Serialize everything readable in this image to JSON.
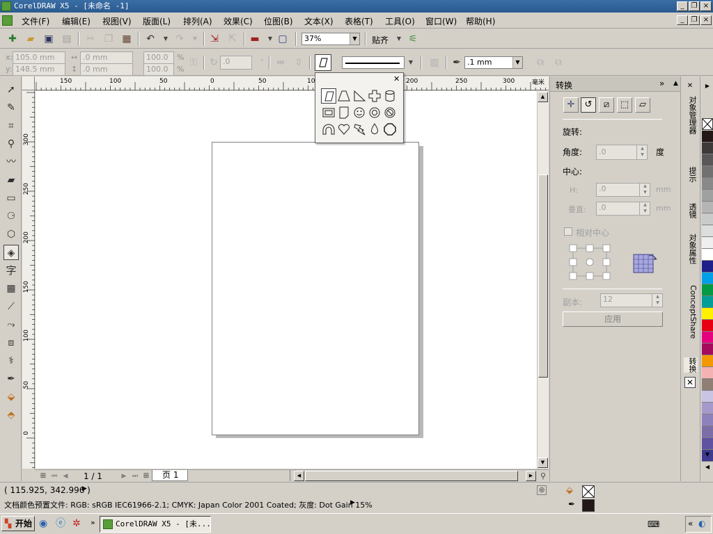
{
  "window": {
    "title": "CorelDRAW X5 - [未命名 -1]",
    "controls": [
      "_",
      "❐",
      "×"
    ]
  },
  "menu": {
    "items": [
      "文件(F)",
      "编辑(E)",
      "视图(V)",
      "版面(L)",
      "排列(A)",
      "效果(C)",
      "位图(B)",
      "文本(X)",
      "表格(T)",
      "工具(O)",
      "窗口(W)",
      "帮助(H)"
    ]
  },
  "standard_toolbar": {
    "zoom_value": "37%",
    "snap_label": "贴齐"
  },
  "property_bar": {
    "x_label": "x:",
    "x_value": "105.0 mm",
    "y_label": "y:",
    "y_value": "148.5 mm",
    "w_value": ".0 mm",
    "h_value": ".0 mm",
    "scale_x": "100.0",
    "scale_y": "100.0",
    "percent": "%",
    "rotate_value": ".0",
    "outline_width": ".1 mm"
  },
  "rulers": {
    "unit": "毫米",
    "top_ticks": [
      "150",
      "100",
      "50",
      "0",
      "50",
      "100",
      "150",
      "200",
      "250",
      "300"
    ],
    "left_ticks": [
      "300",
      "250",
      "200",
      "150",
      "100",
      "50",
      "0"
    ]
  },
  "navigator": {
    "page_count": "1 / 1",
    "page_tab": "页 1"
  },
  "docker": {
    "title": "转换",
    "rotation_label": "旋转:",
    "angle_label": "角度:",
    "angle_value": ".0",
    "angle_unit": "度",
    "center_label": "中心:",
    "h_label": "H:",
    "h_value": ".0",
    "v_label": "垂直:",
    "v_value": ".0",
    "unit_mm": "mm",
    "relative_center": "相对中心",
    "copies_label": "副本:",
    "copies_value": "12",
    "apply_label": "应用"
  },
  "side_tabs": [
    "对象管理器",
    "提示",
    "透镜",
    "对象属性",
    "ConceptShare",
    "转换"
  ],
  "palette_colors": [
    "#231815",
    "#3e3a39",
    "#595757",
    "#727171",
    "#898989",
    "#9fa0a0",
    "#b5b5b6",
    "#c9caca",
    "#dcdddd",
    "#efefef",
    "#ffffff",
    "#1d2088",
    "#00a0e9",
    "#009944",
    "#009e96",
    "#fff100",
    "#e60012",
    "#e4007f",
    "#a40b5d",
    "#f39800",
    "#f5b2b2",
    "#8f7f74",
    "#c9c4e4",
    "#a59aca",
    "#8e82bc",
    "#7c6fa8",
    "#5f52a0",
    "#3e3a8f"
  ],
  "status": {
    "coords": "( 115.925, 342.996 )",
    "color_profile": "文档颜色预置文件: RGB: sRGB IEC61966-2.1; CMYK: Japan Color 2001 Coated; 灰度: Dot Gain 15%"
  },
  "taskbar": {
    "start_label": "开始",
    "task_label": "CorelDRAW X5 - [未..."
  }
}
